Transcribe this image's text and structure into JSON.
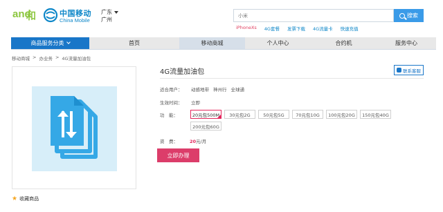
{
  "header": {
    "logo_and_text": "和",
    "logo_cm_cn": "中国移动",
    "logo_cm_en": "China Mobile",
    "province": "广东",
    "city": "广州",
    "search_placeholder": "小米",
    "search_button": "搜索",
    "hotwords": [
      "iPhoneXs",
      "4G套餐",
      "发票下载",
      "4G流量卡",
      "快速充值"
    ]
  },
  "nav": {
    "category": "商品服务分类",
    "items": [
      "首页",
      "移动商城",
      "个人中心",
      "合约机",
      "服务中心"
    ]
  },
  "breadcrumb": [
    "移动商城",
    ">",
    "办业务",
    ">",
    "4G流量加油包"
  ],
  "product": {
    "title": "4G流量加油包",
    "service_button": "联系客服",
    "users_label": "适合用户：",
    "users": [
      "动感地带",
      "神州行",
      "全球通"
    ],
    "effective_label": "生效时间：",
    "effective_value": "立即",
    "function_label": "功　能：",
    "options": [
      "20元包500M",
      "30元包2G",
      "50元包5G",
      "70元包10G",
      "100元包20G",
      "150元包40G",
      "200元包60G"
    ],
    "selected_option": "20元包500M",
    "price_label": "资　费：",
    "price_value": "20",
    "price_unit": "元/月",
    "buy_button": "立即办理",
    "favorite": "收藏商品"
  },
  "colors": {
    "brand_blue": "#1976c8",
    "accent_pink": "#dc3d6a",
    "logo_green": "#8cc63f"
  }
}
